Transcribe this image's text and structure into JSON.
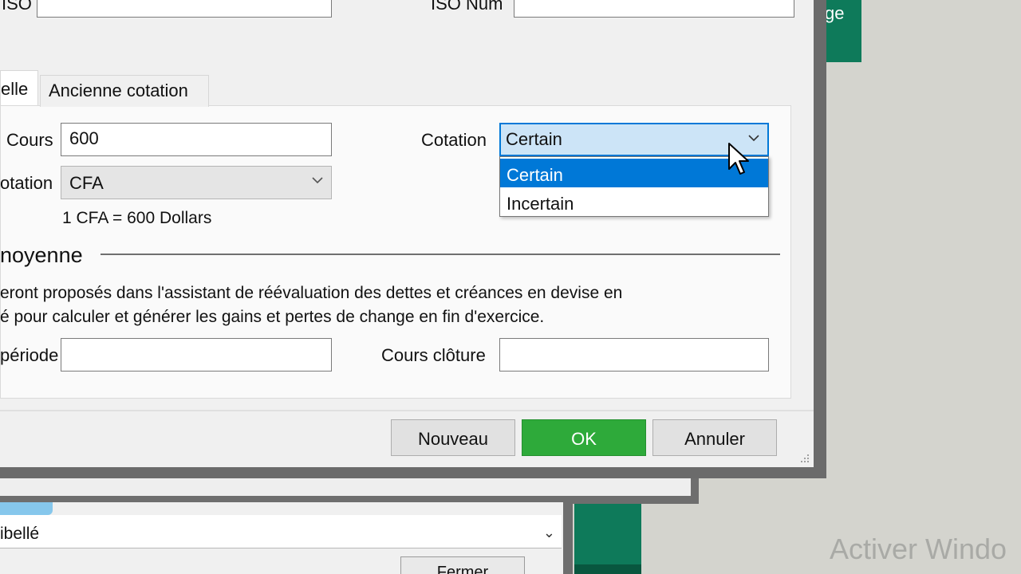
{
  "background": {
    "green_tile_text": "ge",
    "back_window": {
      "list_label": "ibellé",
      "fermer_label": "Fermer"
    },
    "watermark": "Activer Windo"
  },
  "dialog": {
    "top_fields": {
      "iso_label": "ISO",
      "iso_num_label": "ISO Num",
      "iso_value": "",
      "iso_num_value": ""
    },
    "tabs": [
      {
        "label": "elle",
        "active": true
      },
      {
        "label": "Ancienne cotation",
        "active": false
      }
    ],
    "cours": {
      "label": "Cours",
      "value": "600"
    },
    "cotation": {
      "label": "Cotation",
      "value": "Certain",
      "options": [
        "Certain",
        "Incertain"
      ],
      "highlighted": "Certain"
    },
    "devise_cotation": {
      "label": "otation",
      "value": "CFA"
    },
    "conversion_text": "1 CFA = 600 Dollars",
    "section": {
      "title": "noyenne",
      "description_line1": "eront proposés dans l'assistant de réévaluation des dettes et créances en devise en",
      "description_line2": "é pour calculer et générer les gains et pertes de change en fin d'exercice."
    },
    "periode": {
      "label": "période",
      "value": ""
    },
    "cours_cloture": {
      "label": "Cours clôture",
      "value": ""
    },
    "buttons": {
      "nouveau": "Nouveau",
      "ok": "OK",
      "annuler": "Annuler"
    },
    "colors": {
      "ok_button": "#2eaa3a",
      "selection": "#0078d7",
      "frame": "#6b6b6b",
      "app_green": "#0e7a5a"
    }
  }
}
